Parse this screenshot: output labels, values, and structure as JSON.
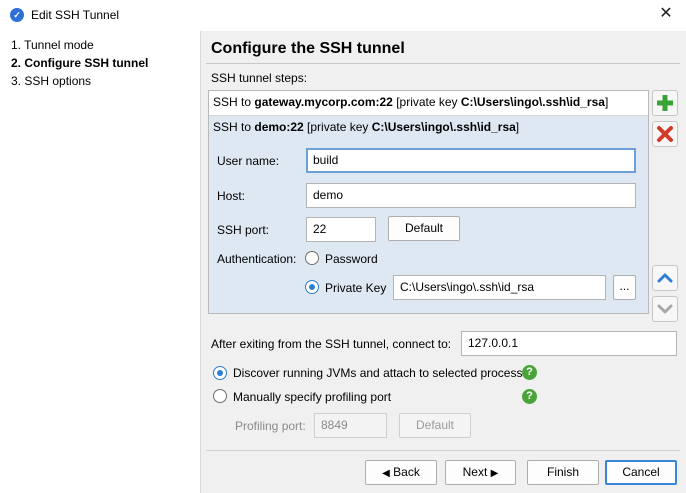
{
  "window": {
    "title": "Edit SSH Tunnel"
  },
  "steps": [
    "1. Tunnel mode",
    "2. Configure SSH tunnel",
    "3. SSH options"
  ],
  "heading": "Configure the SSH tunnel",
  "tunnel_steps_label": "SSH tunnel steps:",
  "tunnels": [
    {
      "prefix": "SSH to ",
      "host": "gateway.mycorp.com:22",
      "mid": " [private key ",
      "key": "C:\\Users\\ingo\\.ssh\\id_rsa",
      "suffix": "]"
    },
    {
      "prefix": "SSH to ",
      "host": "demo:22",
      "mid": " [private key ",
      "key": "C:\\Users\\ingo\\.ssh\\id_rsa",
      "suffix": "]"
    }
  ],
  "form": {
    "user_label": "User name:",
    "user_value": "build",
    "host_label": "Host:",
    "host_value": "demo",
    "port_label": "SSH port:",
    "port_value": "22",
    "default_label": "Default",
    "auth_label": "Authentication:",
    "password_label": "Password",
    "private_key_label": "Private Key",
    "private_key_value": "C:\\Users\\ingo\\.ssh\\id_rsa",
    "browse_label": "..."
  },
  "connect": {
    "label": "After exiting from the SSH tunnel, connect to:",
    "value": "127.0.0.1"
  },
  "discover_label": "Discover running JVMs and attach to selected process",
  "manual_label": "Manually specify profiling port",
  "profiling": {
    "label": "Profiling port:",
    "value": "8849",
    "default_label": "Default"
  },
  "buttons": {
    "back": "Back",
    "next": "Next",
    "finish": "Finish",
    "cancel": "Cancel"
  },
  "colors": {
    "accent": "#2d7fd3",
    "selection": "#dde8f3",
    "add": "#3aa336",
    "remove": "#d23a2a",
    "help": "#4aa43a"
  },
  "icons": [
    "app-icon",
    "close-icon",
    "add-icon",
    "remove-icon",
    "move-up-icon",
    "move-down-icon",
    "help-icon",
    "arrow-left-icon",
    "arrow-right-icon"
  ]
}
